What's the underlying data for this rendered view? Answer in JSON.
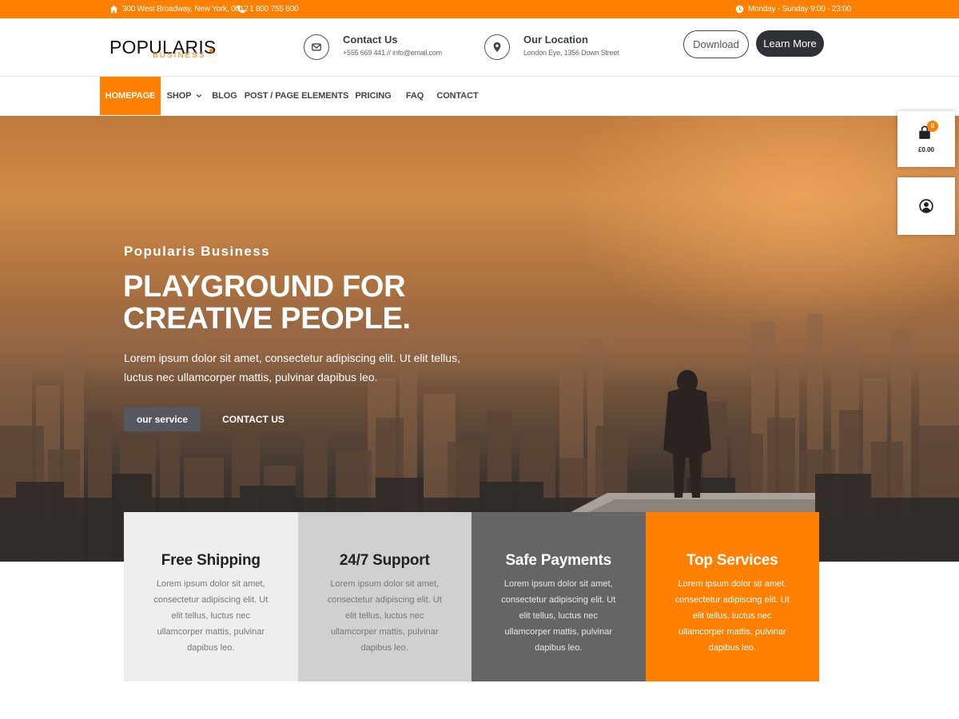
{
  "topbar": {
    "address": "300 West Broadway, New York, 0012",
    "phone": "1 800 755 600",
    "hours": "Monday - Sunday 9:00 - 23:00",
    "color": "#ff7f00"
  },
  "header": {
    "logo_main": "POPULARIS",
    "logo_sub": "BUSINESS",
    "contact": {
      "title": "Contact Us",
      "detail": "+555 669 441 // info@email.com",
      "icon": "envelope-icon"
    },
    "location": {
      "title": "Our Location",
      "detail": "London Eye, 1356 Down Street",
      "icon": "map-pin-icon"
    },
    "download_label": "Download",
    "learn_more_label": "Learn More"
  },
  "nav": {
    "items": [
      {
        "label": "HOMEPAGE"
      },
      {
        "label": "SHOP"
      },
      {
        "label": "BLOG"
      },
      {
        "label": "POST / PAGE ELEMENTS"
      },
      {
        "label": "PRICING"
      },
      {
        "label": "FAQ"
      },
      {
        "label": "CONTACT"
      }
    ]
  },
  "hero": {
    "eyebrow": "Popularis Business",
    "title_line1": "PLAYGROUND FOR",
    "title_line2": "CREATIVE PEOPLE.",
    "text": "Lorem ipsum dolor sit amet, consectetur adipiscing elit. Ut elit tellus, luctus nec ullamcorper mattis, pulvinar dapibus leo.",
    "primary_button": "our service",
    "secondary_button": "CONTACT US"
  },
  "cart": {
    "count": "0",
    "total": "£0.00"
  },
  "features": [
    {
      "title": "Free Shipping",
      "text": "Lorem ipsum dolor sit amet, consectetur adipiscing elit. Ut elit tellus, luctus nec ullamcorper mattis, pulvinar dapibus leo."
    },
    {
      "title": "24/7 Support",
      "text": "Lorem ipsum dolor sit amet, consectetur adipiscing elit. Ut elit tellus, luctus nec ullamcorper mattis, pulvinar dapibus leo."
    },
    {
      "title": "Safe Payments",
      "text": "Lorem ipsum dolor sit amet, consectetur adipiscing elit. Ut elit tellus, luctus nec ullamcorper mattis, pulvinar dapibus leo."
    },
    {
      "title": "Top Services",
      "text": "Lorem ipsum dolor sit amet, consectetur adipiscing elit. Ut elit tellus, luctus nec ullamcorper mattis, pulvinar dapibus leo."
    }
  ]
}
